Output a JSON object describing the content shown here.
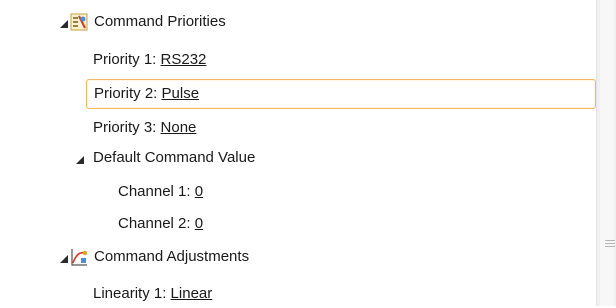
{
  "tree": {
    "command_priorities": {
      "label": "Command Priorities",
      "icon": "command-priorities-icon",
      "priority1": {
        "label": "Priority 1:",
        "value": "RS232"
      },
      "priority2": {
        "label": "Priority 2:",
        "value": "Pulse"
      },
      "priority3": {
        "label": "Priority 3:",
        "value": "None"
      },
      "default_command_value": {
        "label": "Default Command Value",
        "channel1": {
          "label": "Channel 1:",
          "value": "0"
        },
        "channel2": {
          "label": "Channel 2:",
          "value": "0"
        }
      }
    },
    "command_adjustments": {
      "label": "Command Adjustments",
      "icon": "command-adjustments-icon",
      "linearity1": {
        "label": "Linearity 1:",
        "value": "Linear"
      }
    }
  },
  "colors": {
    "selection_border": "#f2b866",
    "text": "#1a1a1a"
  }
}
